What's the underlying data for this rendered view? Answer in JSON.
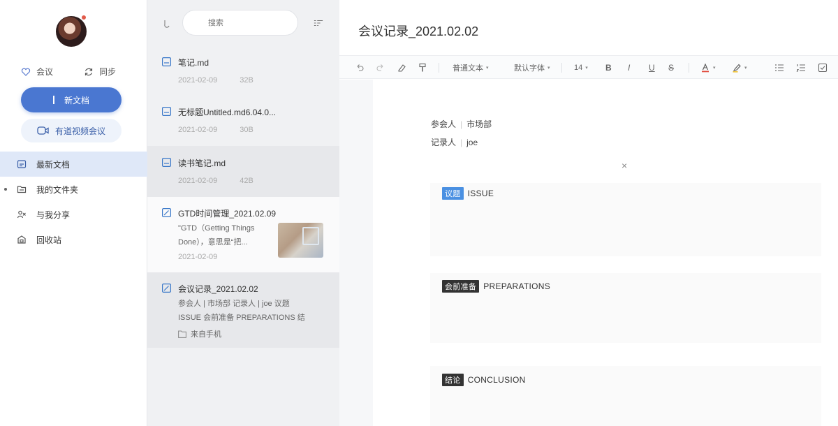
{
  "sidebar": {
    "quick": [
      {
        "label": "会议",
        "icon": "heart-icon"
      },
      {
        "label": "同步",
        "icon": "sync-icon"
      }
    ],
    "new_button": "新文档",
    "meeting_button": "有道视频会议",
    "nav": [
      {
        "label": "最新文档",
        "icon": "clock-doc-icon",
        "active": true
      },
      {
        "label": "我的文件夹",
        "icon": "folder-icon",
        "active": false
      },
      {
        "label": "与我分享",
        "icon": "share-icon",
        "active": false
      },
      {
        "label": "回收站",
        "icon": "trash-icon",
        "active": false
      }
    ]
  },
  "list": {
    "search_placeholder": "搜索",
    "docs": [
      {
        "title": "笔记.md",
        "date": "2021-02-09",
        "size": "32B"
      },
      {
        "title": "无标题Untitled.md6.04.0...",
        "date": "2021-02-09",
        "size": "30B"
      },
      {
        "title": "读书笔记.md",
        "date": "2021-02-09",
        "size": "42B"
      },
      {
        "title": "GTD时间管理_2021.02.09",
        "snippet": [
          "\"GTD（Getting Things",
          "Done），意思是“把..."
        ],
        "date": "2021-02-09"
      },
      {
        "title": "会议记录_2021.02.02",
        "snippet": [
          "参会人 | 市场部 记录人 | joe 议题",
          "ISSUE 会前准备 PREPARATIONS 结"
        ],
        "folder": "来自手机"
      }
    ]
  },
  "editor": {
    "title": "会议记录_2021.02.02",
    "toolbar": {
      "text_style": "普通文本",
      "font": "默认字体",
      "font_size": "14",
      "bold": "B",
      "italic": "I",
      "underline": "U",
      "strike": "S"
    },
    "fields": [
      {
        "label": "参会人",
        "value": "市场部"
      },
      {
        "label": "记录人",
        "value": "joe"
      }
    ],
    "close_symbol": "×",
    "sections": [
      {
        "tag": "议题",
        "tag_color": "#4a90e2",
        "label": "ISSUE"
      },
      {
        "tag": "会前准备",
        "tag_color": "#333333",
        "label": "PREPARATIONS"
      },
      {
        "tag": "结论",
        "tag_color": "#333333",
        "label": "CONCLUSION"
      }
    ]
  }
}
